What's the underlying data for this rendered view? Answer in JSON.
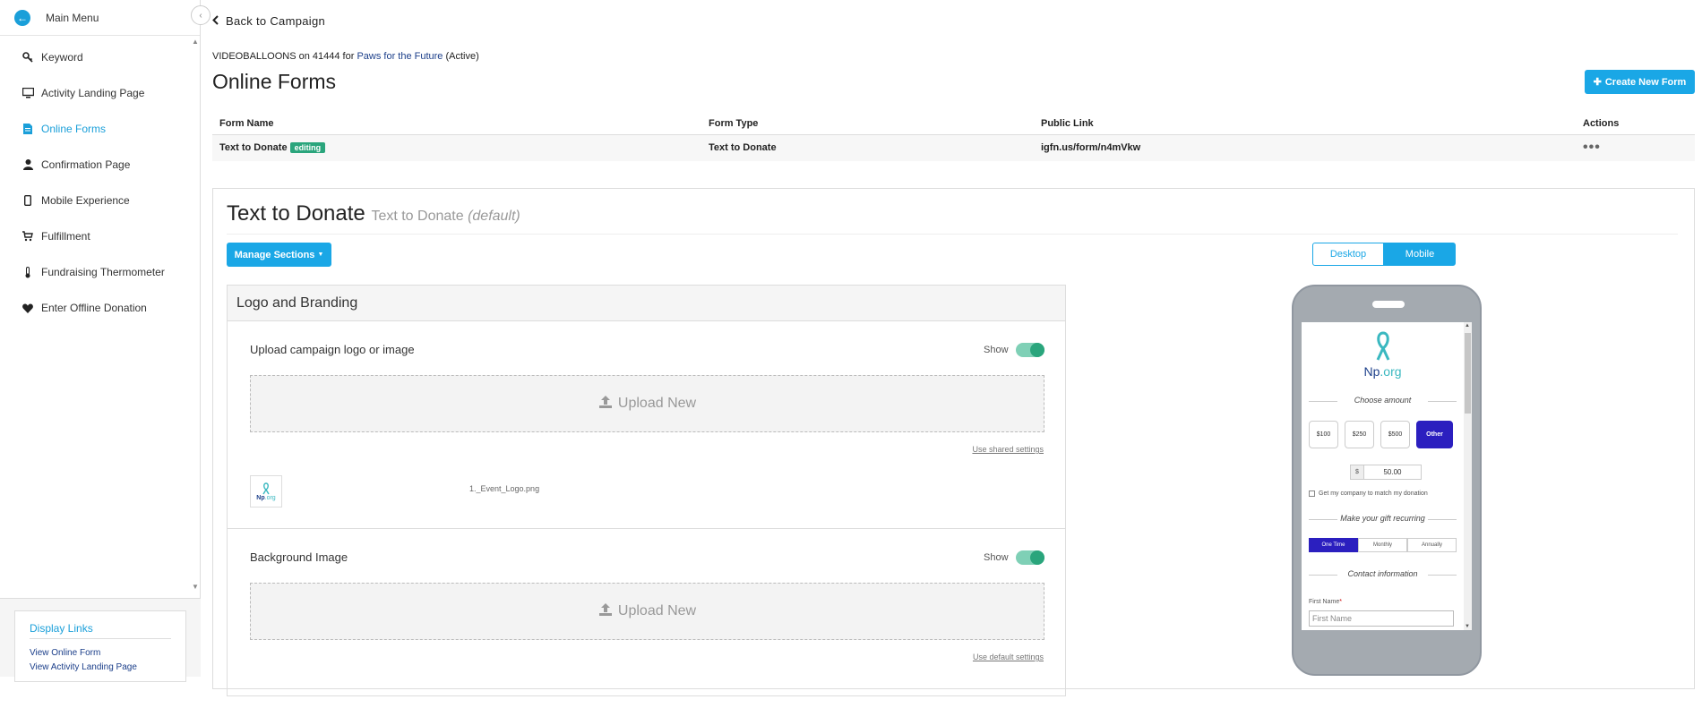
{
  "sidebar": {
    "header_title": "Main Menu",
    "items": [
      {
        "label": "Keyword",
        "icon": "key-icon"
      },
      {
        "label": "Activity Landing Page",
        "icon": "monitor-icon"
      },
      {
        "label": "Online Forms",
        "icon": "document-icon",
        "active": true
      },
      {
        "label": "Confirmation Page",
        "icon": "user-icon"
      },
      {
        "label": "Mobile Experience",
        "icon": "mobile-icon"
      },
      {
        "label": "Fulfillment",
        "icon": "cart-icon"
      },
      {
        "label": "Fundraising Thermometer",
        "icon": "thermometer-icon"
      },
      {
        "label": "Enter Offline Donation",
        "icon": "heart-icon"
      }
    ],
    "display_links": {
      "title": "Display Links",
      "links": [
        "View Online Form",
        "View Activity Landing Page"
      ]
    }
  },
  "header": {
    "back_label": "Back to Campaign",
    "crumb_keyword": "VIDEOBALLOONS on 41444 for",
    "crumb_campaign": "Paws for the Future",
    "crumb_status": "(Active)",
    "title": "Online Forms",
    "create_label": "Create New Form"
  },
  "table": {
    "columns": [
      "Form Name",
      "Form Type",
      "Public Link",
      "Actions"
    ],
    "rows": [
      {
        "name": "Text to Donate",
        "badge": "editing",
        "type": "Text to Donate",
        "link": "igfn.us/form/n4mVkw",
        "actions": "•••"
      }
    ]
  },
  "editor": {
    "title": "Text to Donate",
    "subtitle": "Text to Donate",
    "subtitle_tag": "(default)",
    "manage_label": "Manage Sections",
    "view_toggle": {
      "desktop": "Desktop",
      "mobile": "Mobile",
      "selected": "Mobile"
    },
    "section_title": "Logo and Branding",
    "logo": {
      "label": "Upload campaign logo or image",
      "show_label": "Show",
      "show_on": true,
      "upload_label": "Upload New",
      "settings_link": "Use shared settings",
      "filename": "1._Event_Logo.png"
    },
    "background": {
      "label": "Background Image",
      "show_label": "Show",
      "show_on": true,
      "upload_label": "Upload New",
      "settings_link": "Use default settings"
    }
  },
  "preview": {
    "logo_np": "Np",
    "logo_org": ".org",
    "choose_amount": "Choose amount",
    "amounts": [
      "$100",
      "$250",
      "$500",
      "Other"
    ],
    "selected_amount": "Other",
    "currency": "$",
    "amount_value": "50.00",
    "match_label": "Get my company to match my donation",
    "recurring_title": "Make your gift recurring",
    "recurring_options": [
      "One Time",
      "Monthly",
      "Annually"
    ],
    "contact_title": "Contact information",
    "first_name_label": "First Name",
    "first_name_required": "*",
    "first_name_placeholder": "First Name"
  },
  "colors": {
    "accent": "#1aa7e6",
    "success": "#2aa57c",
    "selected_purple": "#2b1fbf",
    "link_navy": "#1c3f8a"
  }
}
